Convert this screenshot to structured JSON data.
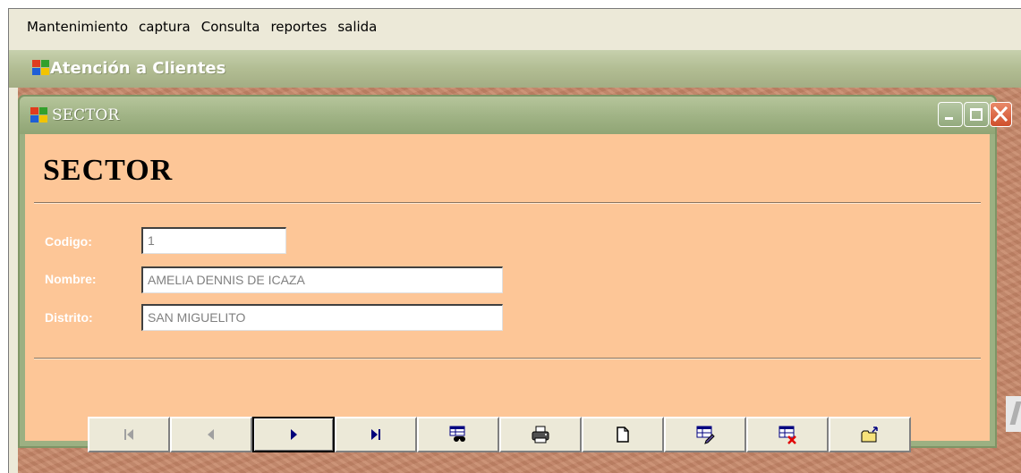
{
  "menu": {
    "items": [
      "Mantenimiento",
      "captura",
      "Consulta",
      "reportes",
      "salida"
    ]
  },
  "app": {
    "title": "Atención a Clientes"
  },
  "window": {
    "title": "SECTOR",
    "heading": "SECTOR"
  },
  "form": {
    "codigo_label": "Codigo:",
    "codigo_value": "1",
    "nombre_label": "Nombre:",
    "nombre_value": "AMELIA DENNIS DE ICAZA",
    "distrito_label": "Distrito:",
    "distrito_value": "SAN MIGUELITO"
  },
  "toolbar": {
    "buttons": [
      {
        "icon": "first-record-icon",
        "enabled": false
      },
      {
        "icon": "previous-record-icon",
        "enabled": false
      },
      {
        "icon": "next-record-icon",
        "enabled": true
      },
      {
        "icon": "last-record-icon",
        "enabled": true
      },
      {
        "icon": "find-icon",
        "enabled": true
      },
      {
        "icon": "print-icon",
        "enabled": true
      },
      {
        "icon": "new-record-icon",
        "enabled": true
      },
      {
        "icon": "edit-record-icon",
        "enabled": true
      },
      {
        "icon": "delete-record-icon",
        "enabled": true
      },
      {
        "icon": "exit-icon",
        "enabled": true
      }
    ]
  },
  "colors": {
    "form_background": "#fdc697",
    "title_bar": "#9fb284",
    "close_button": "#d04f2c",
    "desktop": "#c78a6c"
  }
}
